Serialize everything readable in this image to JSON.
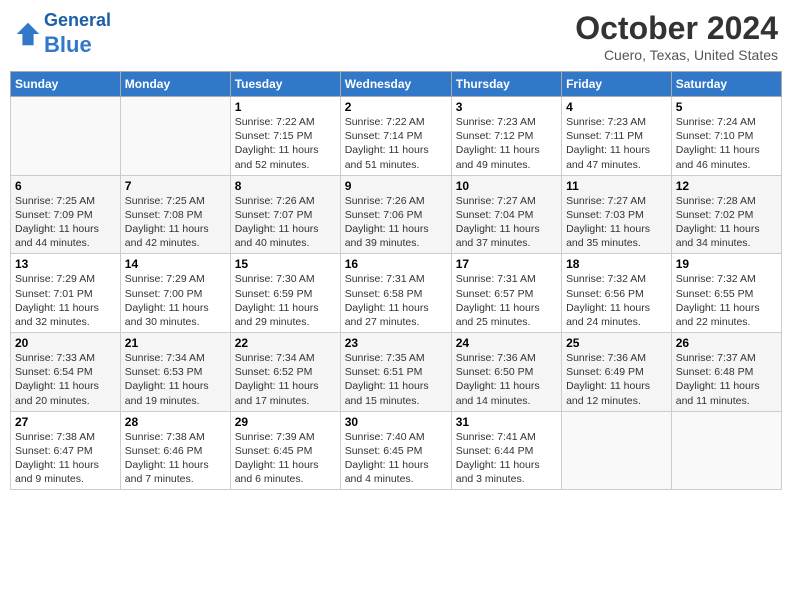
{
  "header": {
    "logo_line1": "General",
    "logo_line2": "Blue",
    "month": "October 2024",
    "location": "Cuero, Texas, United States"
  },
  "weekdays": [
    "Sunday",
    "Monday",
    "Tuesday",
    "Wednesday",
    "Thursday",
    "Friday",
    "Saturday"
  ],
  "weeks": [
    [
      {
        "day": "",
        "info": ""
      },
      {
        "day": "",
        "info": ""
      },
      {
        "day": "1",
        "info": "Sunrise: 7:22 AM\nSunset: 7:15 PM\nDaylight: 11 hours and 52 minutes."
      },
      {
        "day": "2",
        "info": "Sunrise: 7:22 AM\nSunset: 7:14 PM\nDaylight: 11 hours and 51 minutes."
      },
      {
        "day": "3",
        "info": "Sunrise: 7:23 AM\nSunset: 7:12 PM\nDaylight: 11 hours and 49 minutes."
      },
      {
        "day": "4",
        "info": "Sunrise: 7:23 AM\nSunset: 7:11 PM\nDaylight: 11 hours and 47 minutes."
      },
      {
        "day": "5",
        "info": "Sunrise: 7:24 AM\nSunset: 7:10 PM\nDaylight: 11 hours and 46 minutes."
      }
    ],
    [
      {
        "day": "6",
        "info": "Sunrise: 7:25 AM\nSunset: 7:09 PM\nDaylight: 11 hours and 44 minutes."
      },
      {
        "day": "7",
        "info": "Sunrise: 7:25 AM\nSunset: 7:08 PM\nDaylight: 11 hours and 42 minutes."
      },
      {
        "day": "8",
        "info": "Sunrise: 7:26 AM\nSunset: 7:07 PM\nDaylight: 11 hours and 40 minutes."
      },
      {
        "day": "9",
        "info": "Sunrise: 7:26 AM\nSunset: 7:06 PM\nDaylight: 11 hours and 39 minutes."
      },
      {
        "day": "10",
        "info": "Sunrise: 7:27 AM\nSunset: 7:04 PM\nDaylight: 11 hours and 37 minutes."
      },
      {
        "day": "11",
        "info": "Sunrise: 7:27 AM\nSunset: 7:03 PM\nDaylight: 11 hours and 35 minutes."
      },
      {
        "day": "12",
        "info": "Sunrise: 7:28 AM\nSunset: 7:02 PM\nDaylight: 11 hours and 34 minutes."
      }
    ],
    [
      {
        "day": "13",
        "info": "Sunrise: 7:29 AM\nSunset: 7:01 PM\nDaylight: 11 hours and 32 minutes."
      },
      {
        "day": "14",
        "info": "Sunrise: 7:29 AM\nSunset: 7:00 PM\nDaylight: 11 hours and 30 minutes."
      },
      {
        "day": "15",
        "info": "Sunrise: 7:30 AM\nSunset: 6:59 PM\nDaylight: 11 hours and 29 minutes."
      },
      {
        "day": "16",
        "info": "Sunrise: 7:31 AM\nSunset: 6:58 PM\nDaylight: 11 hours and 27 minutes."
      },
      {
        "day": "17",
        "info": "Sunrise: 7:31 AM\nSunset: 6:57 PM\nDaylight: 11 hours and 25 minutes."
      },
      {
        "day": "18",
        "info": "Sunrise: 7:32 AM\nSunset: 6:56 PM\nDaylight: 11 hours and 24 minutes."
      },
      {
        "day": "19",
        "info": "Sunrise: 7:32 AM\nSunset: 6:55 PM\nDaylight: 11 hours and 22 minutes."
      }
    ],
    [
      {
        "day": "20",
        "info": "Sunrise: 7:33 AM\nSunset: 6:54 PM\nDaylight: 11 hours and 20 minutes."
      },
      {
        "day": "21",
        "info": "Sunrise: 7:34 AM\nSunset: 6:53 PM\nDaylight: 11 hours and 19 minutes."
      },
      {
        "day": "22",
        "info": "Sunrise: 7:34 AM\nSunset: 6:52 PM\nDaylight: 11 hours and 17 minutes."
      },
      {
        "day": "23",
        "info": "Sunrise: 7:35 AM\nSunset: 6:51 PM\nDaylight: 11 hours and 15 minutes."
      },
      {
        "day": "24",
        "info": "Sunrise: 7:36 AM\nSunset: 6:50 PM\nDaylight: 11 hours and 14 minutes."
      },
      {
        "day": "25",
        "info": "Sunrise: 7:36 AM\nSunset: 6:49 PM\nDaylight: 11 hours and 12 minutes."
      },
      {
        "day": "26",
        "info": "Sunrise: 7:37 AM\nSunset: 6:48 PM\nDaylight: 11 hours and 11 minutes."
      }
    ],
    [
      {
        "day": "27",
        "info": "Sunrise: 7:38 AM\nSunset: 6:47 PM\nDaylight: 11 hours and 9 minutes."
      },
      {
        "day": "28",
        "info": "Sunrise: 7:38 AM\nSunset: 6:46 PM\nDaylight: 11 hours and 7 minutes."
      },
      {
        "day": "29",
        "info": "Sunrise: 7:39 AM\nSunset: 6:45 PM\nDaylight: 11 hours and 6 minutes."
      },
      {
        "day": "30",
        "info": "Sunrise: 7:40 AM\nSunset: 6:45 PM\nDaylight: 11 hours and 4 minutes."
      },
      {
        "day": "31",
        "info": "Sunrise: 7:41 AM\nSunset: 6:44 PM\nDaylight: 11 hours and 3 minutes."
      },
      {
        "day": "",
        "info": ""
      },
      {
        "day": "",
        "info": ""
      }
    ]
  ]
}
